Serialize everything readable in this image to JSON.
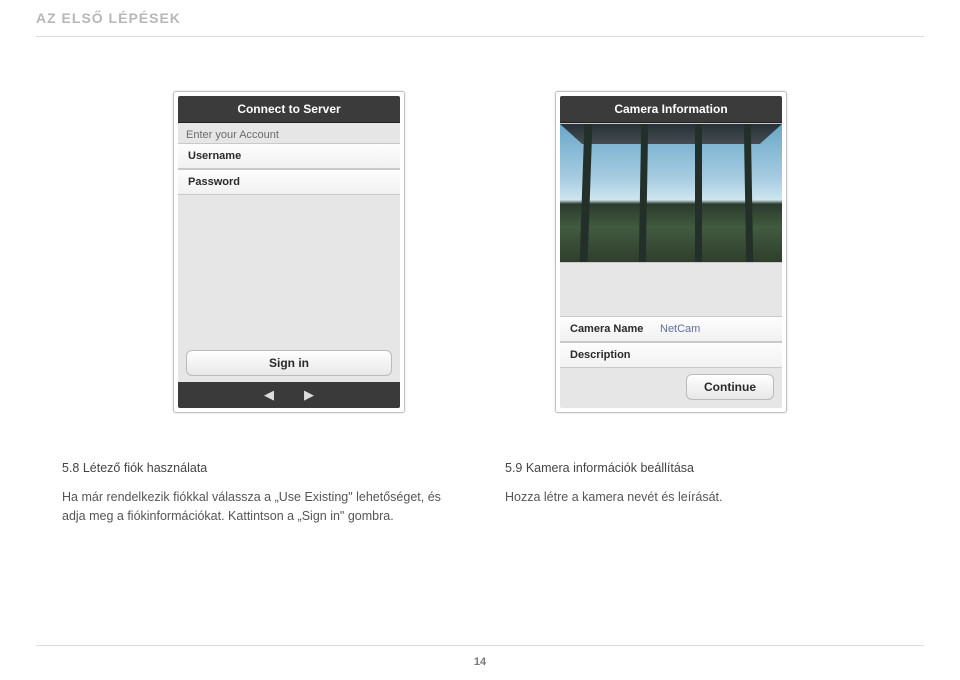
{
  "header": "AZ ELSŐ LÉPÉSEK",
  "page_number": "14",
  "left_screenshot": {
    "title": "Connect to Server",
    "prompt": "Enter your Account",
    "username_label": "Username",
    "password_label": "Password",
    "signin_label": "Sign in"
  },
  "right_screenshot": {
    "title": "Camera Information",
    "camera_name_label": "Camera Name",
    "camera_name_value": "NetCam",
    "description_label": "Description",
    "continue_label": "Continue"
  },
  "captions": {
    "left": {
      "heading": "5.8 Létező fiók használata",
      "body": "Ha már rendelkezik fiókkal válassza a „Use Existing\" lehetőséget, és adja meg a fiókinformációkat. Kattintson a „Sign in\" gombra."
    },
    "right": {
      "heading": "5.9 Kamera információk beállítása",
      "body": "Hozza létre a kamera nevét és leírását."
    }
  }
}
